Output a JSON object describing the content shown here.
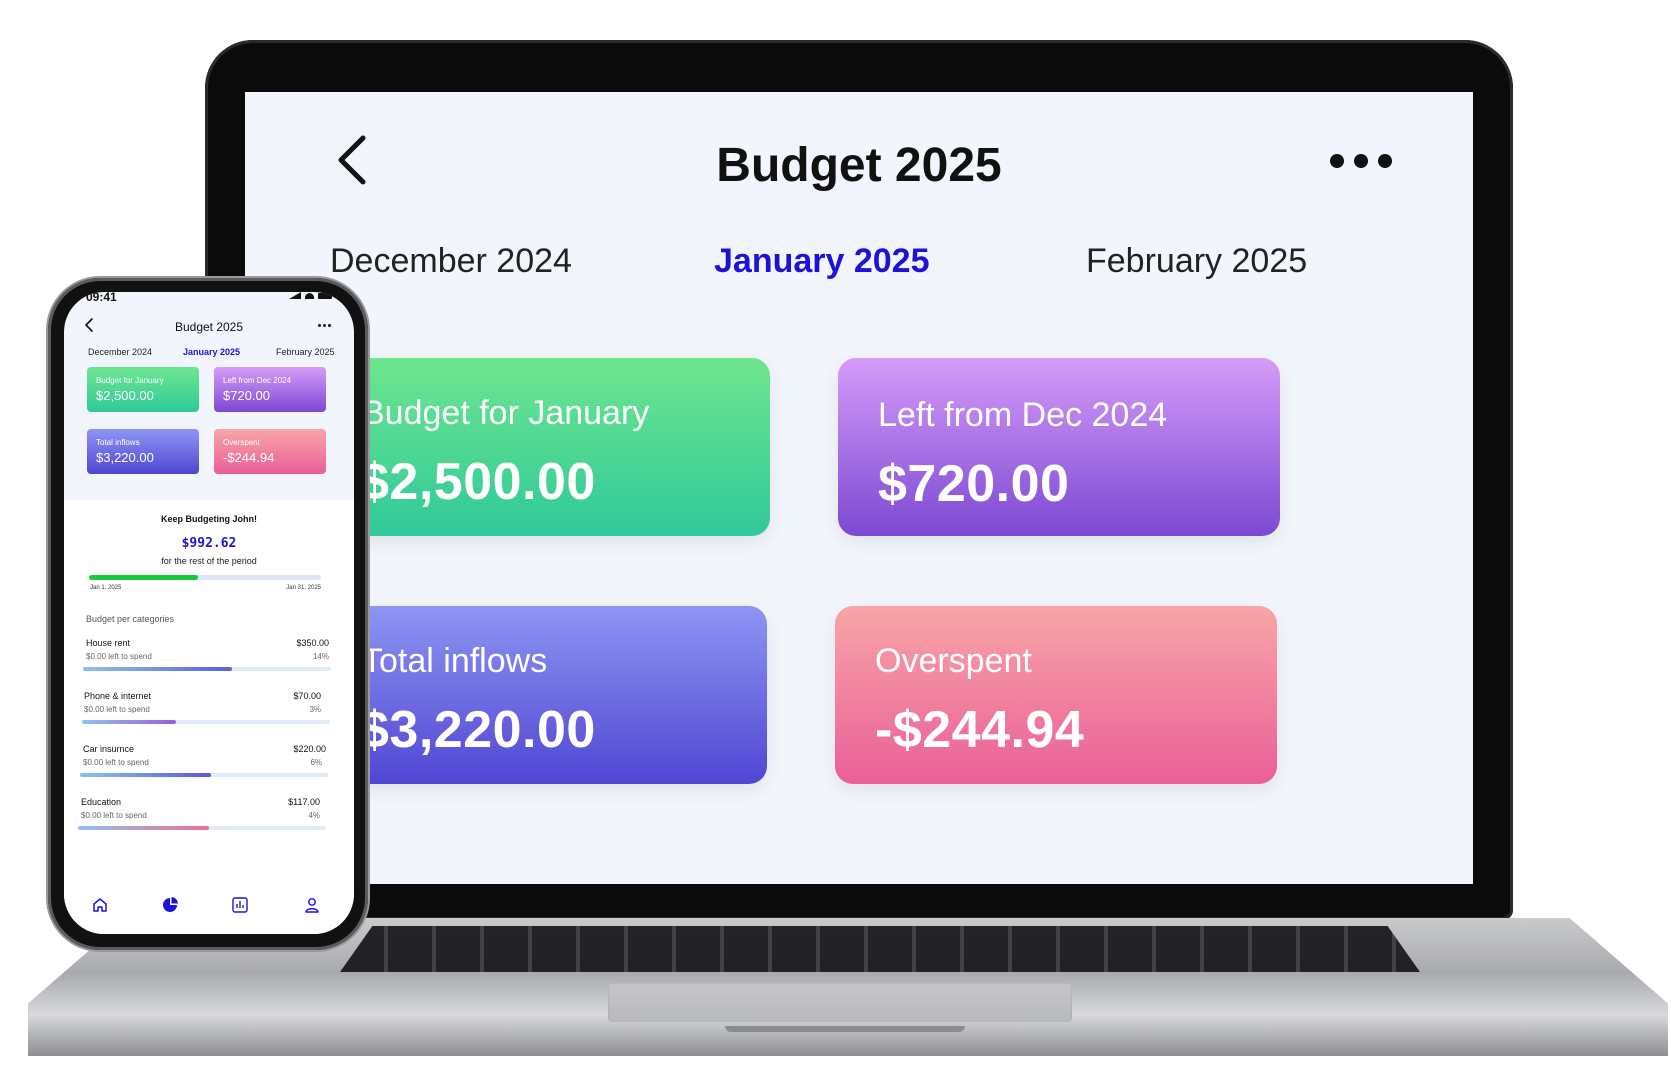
{
  "laptop": {
    "title": "Budget 2025",
    "months": {
      "prev": "December 2024",
      "current": "January 2025",
      "next": "February 2025"
    },
    "cards": [
      {
        "label": "Budget for January",
        "value": "$2,500.00"
      },
      {
        "label": "Left from Dec 2024",
        "value": "$720.00"
      },
      {
        "label": "Total inflows",
        "value": "$3,220.00"
      },
      {
        "label": "Overspent",
        "value": "-$244.94"
      }
    ]
  },
  "phone": {
    "status_time": "09:41",
    "title": "Budget 2025",
    "months": {
      "prev": "December 2024",
      "current": "January 2025",
      "next": "February 2025"
    },
    "cards": [
      {
        "label": "Budget for January",
        "value": "$2,500.00"
      },
      {
        "label": "Left from Dec 2024",
        "value": "$720.00"
      },
      {
        "label": "Total inflows",
        "value": "$3,220.00"
      },
      {
        "label": "Overspent",
        "value": "-$244.94"
      }
    ],
    "summary": {
      "greeting": "Keep Budgeting John!",
      "amount": "$992.62",
      "caption": "for the rest of the period",
      "progress": 0.47,
      "start_date": "Jan 1, 2025",
      "end_date": "Jan 31, 2025"
    },
    "categories_title": "Budget per categories",
    "categories": [
      {
        "name": "House rent",
        "amount": "$350.00",
        "left": "$0.00 left to spend",
        "percent": "14%",
        "progress": 0.6,
        "color": "#5b5fd8"
      },
      {
        "name": "Phone & internet",
        "amount": "$70.00",
        "left": "$0.00 left to spend",
        "percent": "3%",
        "progress": 0.38,
        "color": "#9a5ddc"
      },
      {
        "name": "Car insurnce",
        "amount": "$220.00",
        "left": "$0.00 left to spend",
        "percent": "6%",
        "progress": 0.53,
        "color": "#5b57d6"
      },
      {
        "name": "Education",
        "amount": "$117.00",
        "left": "$0.00 left to spend",
        "percent": "4%",
        "progress": 0.53,
        "color": "#ea6f96"
      }
    ],
    "nav_icons": [
      "home-icon",
      "pie-chart-icon",
      "bar-chart-icon",
      "profile-icon"
    ]
  },
  "colors": {
    "accent": "#1e12d6",
    "progress_green": "#17c93a"
  }
}
